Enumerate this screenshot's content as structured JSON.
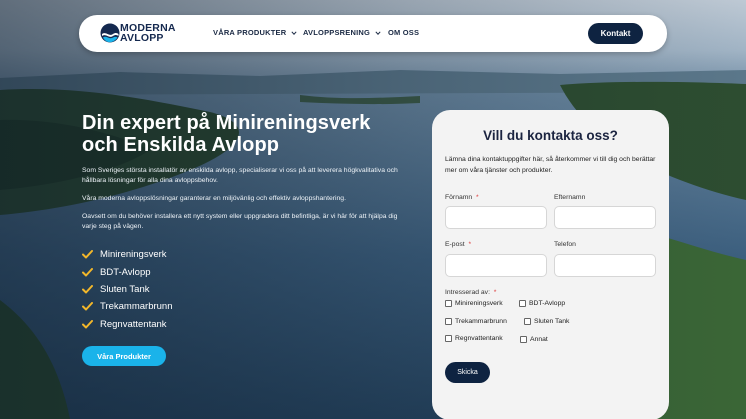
{
  "brand": {
    "line1": "MODERNA",
    "line2": "AVLOPP"
  },
  "nav": {
    "items": [
      {
        "label": "VÅRA PRODUKTER"
      },
      {
        "label": "AVLOPPSRENING"
      },
      {
        "label": "OM OSS"
      }
    ],
    "contact_label": "Kontakt"
  },
  "hero": {
    "title_line1": "Din expert på Minireningsverk",
    "title_line2": "och Enskilda Avlopp",
    "paragraphs": [
      "Som Sveriges största installatör av enskilda avlopp, specialiserar vi oss på att leverera högkvalitativa och hållbara lösningar för alla dina avloppsbehov.",
      "Våra moderna avloppslösningar garanterar en miljövänlig och effektiv avloppshantering.",
      "Oavsett om du behöver installera ett nytt system eller uppgradera ditt befintliga, är vi här för att hjälpa dig varje steg på vägen."
    ],
    "checklist": [
      "Minireningsverk",
      "BDT-Avlopp",
      "Sluten Tank",
      "Trekammarbrunn",
      "Regnvattentank"
    ],
    "cta_label": "Våra Produkter",
    "check_color": "#f3b72a"
  },
  "form": {
    "title": "Vill du kontakta oss?",
    "intro": "Lämna dina kontaktuppgifter här, så återkommer vi till dig och berättar mer om våra tjänster och produkter.",
    "first_name_label": "Förnamn",
    "last_name_label": "Efternamn",
    "email_label": "E-post",
    "phone_label": "Telefon",
    "interest_label": "Intresserad av:",
    "required_mark": "*",
    "options": [
      "Minireningsverk",
      "BDT-Avlopp",
      "Trekammarbrunn",
      "Sluten Tank",
      "Regnvattentank",
      "Annat"
    ],
    "submit_label": "Skicka"
  },
  "colors": {
    "navy": "#0e2341",
    "accent": "#1ab3ea",
    "card": "#f3f3f3"
  }
}
